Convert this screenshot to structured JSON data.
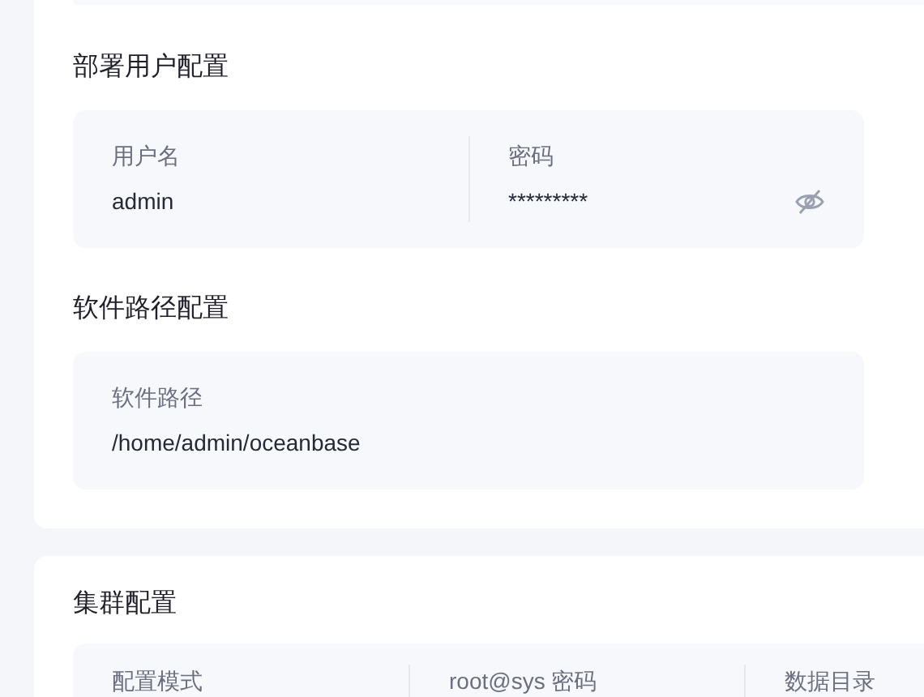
{
  "sections": [
    {
      "title": "部署用户配置",
      "fields": [
        {
          "label": "用户名",
          "value": "admin"
        },
        {
          "label": "密码",
          "value": "*********",
          "kind": "password"
        }
      ]
    },
    {
      "title": "软件路径配置",
      "fields": [
        {
          "label": "软件路径",
          "value": "/home/admin/oceanbase"
        }
      ]
    }
  ],
  "cluster": {
    "title": "集群配置",
    "columns": [
      "配置模式",
      "root@sys 密码",
      "数据目录"
    ]
  }
}
